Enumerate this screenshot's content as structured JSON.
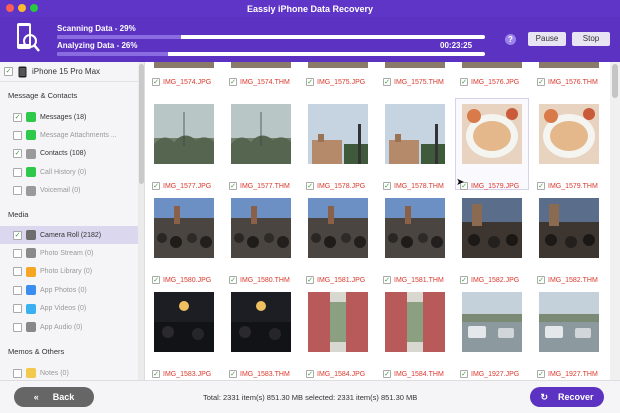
{
  "window": {
    "title": "Eassiy iPhone Data Recovery"
  },
  "progress": {
    "scan_label": "Scanning Data - 29%",
    "scan_value": 0.29,
    "analyze_label": "Analyzing Data - 26%",
    "analyze_value": 0.26,
    "elapsed": "00:23:25",
    "pause_label": "Pause",
    "stop_label": "Stop",
    "help_glyph": "?"
  },
  "sidebar": {
    "device": "iPhone 15 Pro Max",
    "sections": [
      {
        "title": "Message & Contacts",
        "items": [
          {
            "label": "Messages (18)",
            "checked": true,
            "icon": "messages-icon",
            "color": "#2ec94a",
            "dim": false
          },
          {
            "label": "Message Attachments ...",
            "checked": false,
            "icon": "message-attachments-icon",
            "color": "#2ec94a",
            "dim": true
          },
          {
            "label": "Contacts (108)",
            "checked": true,
            "icon": "contacts-icon",
            "color": "#9a9a9a",
            "dim": false
          },
          {
            "label": "Call History (0)",
            "checked": false,
            "icon": "call-history-icon",
            "color": "#2ec94a",
            "dim": true
          },
          {
            "label": "Voicemail (0)",
            "checked": false,
            "icon": "voicemail-icon",
            "color": "#9a9a9a",
            "dim": true
          }
        ]
      },
      {
        "title": "Media",
        "items": [
          {
            "label": "Camera Roll (2182)",
            "checked": true,
            "icon": "camera-roll-icon",
            "color": "#6d6d6d",
            "dim": false,
            "selected": true
          },
          {
            "label": "Photo Stream (0)",
            "checked": false,
            "icon": "photo-stream-icon",
            "color": "#8a8a8a",
            "dim": true
          },
          {
            "label": "Photo Library (0)",
            "checked": false,
            "icon": "photo-library-icon",
            "color": "#f5a623",
            "dim": true
          },
          {
            "label": "App Photos (0)",
            "checked": false,
            "icon": "app-photos-icon",
            "color": "#3a8ef0",
            "dim": true
          },
          {
            "label": "App Videos (0)",
            "checked": false,
            "icon": "app-videos-icon",
            "color": "#3ab0f0",
            "dim": true
          },
          {
            "label": "App Audio (0)",
            "checked": false,
            "icon": "app-audio-icon",
            "color": "#888888",
            "dim": true
          }
        ]
      },
      {
        "title": "Memos & Others",
        "items": [
          {
            "label": "Notes (0)",
            "checked": false,
            "icon": "notes-icon",
            "color": "#f2c94c",
            "dim": true
          }
        ]
      }
    ]
  },
  "grid": {
    "top_row": [
      "IMG_1574.JPG",
      "IMG_1574.THM",
      "IMG_1575.JPG",
      "IMG_1575.THM",
      "IMG_1576.JPG",
      "IMG_1576.THM"
    ],
    "rows": [
      [
        {
          "name": "IMG_1577.JPG",
          "scene": "trees-sky"
        },
        {
          "name": "IMG_1577.THM",
          "scene": "trees-sky"
        },
        {
          "name": "IMG_1578.JPG",
          "scene": "building-sky"
        },
        {
          "name": "IMG_1578.THM",
          "scene": "building-sky"
        },
        {
          "name": "IMG_1579.JPG",
          "scene": "soup",
          "selected": true
        },
        {
          "name": "IMG_1579.THM",
          "scene": "soup"
        }
      ],
      [
        {
          "name": "IMG_1580.JPG",
          "scene": "crowd"
        },
        {
          "name": "IMG_1580.THM",
          "scene": "crowd"
        },
        {
          "name": "IMG_1581.JPG",
          "scene": "crowd"
        },
        {
          "name": "IMG_1581.THM",
          "scene": "crowd"
        },
        {
          "name": "IMG_1582.JPG",
          "scene": "crowd-dusk"
        },
        {
          "name": "IMG_1582.THM",
          "scene": "crowd-dusk"
        }
      ],
      [
        {
          "name": "IMG_1583.JPG",
          "scene": "night"
        },
        {
          "name": "IMG_1583.THM",
          "scene": "night"
        },
        {
          "name": "IMG_1584.JPG",
          "scene": "window"
        },
        {
          "name": "IMG_1584.THM",
          "scene": "window"
        },
        {
          "name": "IMG_1927.JPG",
          "scene": "street"
        },
        {
          "name": "IMG_1927.THM",
          "scene": "street"
        }
      ]
    ]
  },
  "footer": {
    "back_label": "Back",
    "totals": "Total: 2331 item(s) 851.30 MB   selected: 2331 item(s) 851.30 MB",
    "recover_label": "Recover"
  },
  "colors": {
    "brand": "#5b32c2",
    "filename": "#d93a2e",
    "check": "#3b9b3b"
  }
}
